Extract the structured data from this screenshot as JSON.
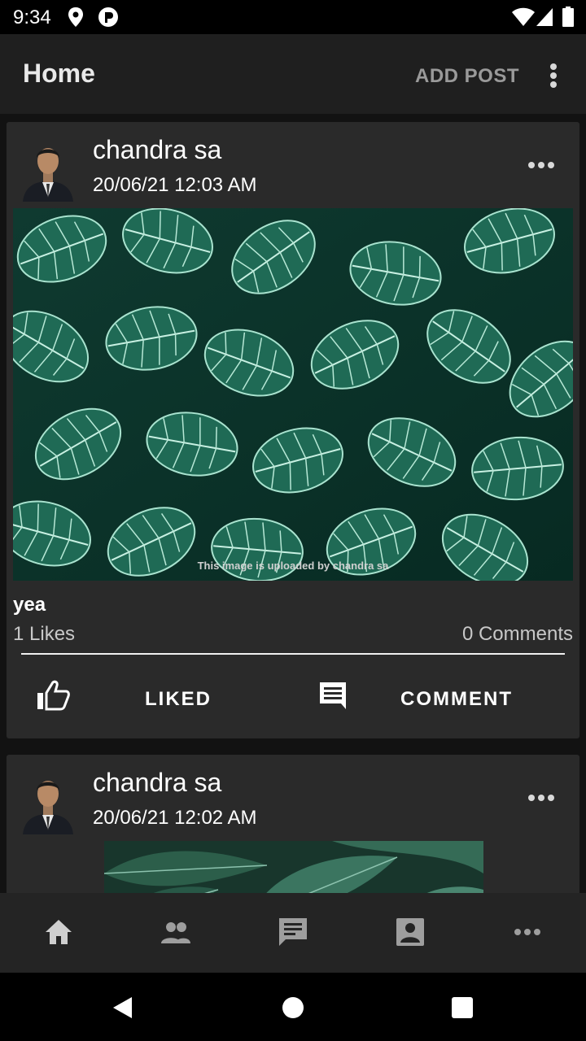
{
  "status": {
    "time": "9:34"
  },
  "appbar": {
    "title": "Home",
    "add_post": "ADD POST"
  },
  "posts": [
    {
      "author": "chandra sa",
      "time": "20/06/21 12:03 AM",
      "watermark": "This image is uploaded by chandra sa",
      "caption": "yea",
      "likes": "1 Likes",
      "comments": "0 Comments",
      "like_label": "LIKED",
      "comment_label": "COMMENT"
    },
    {
      "author": "chandra sa",
      "time": "20/06/21 12:02 AM"
    }
  ],
  "bottom_nav": [
    "home-icon",
    "people-icon",
    "chat-icon",
    "profile-icon",
    "more-icon"
  ],
  "colors": {
    "background": "#121212",
    "card": "#2a2a2a",
    "appbar": "#1f1f1f",
    "leaf": "#1e6b57"
  }
}
